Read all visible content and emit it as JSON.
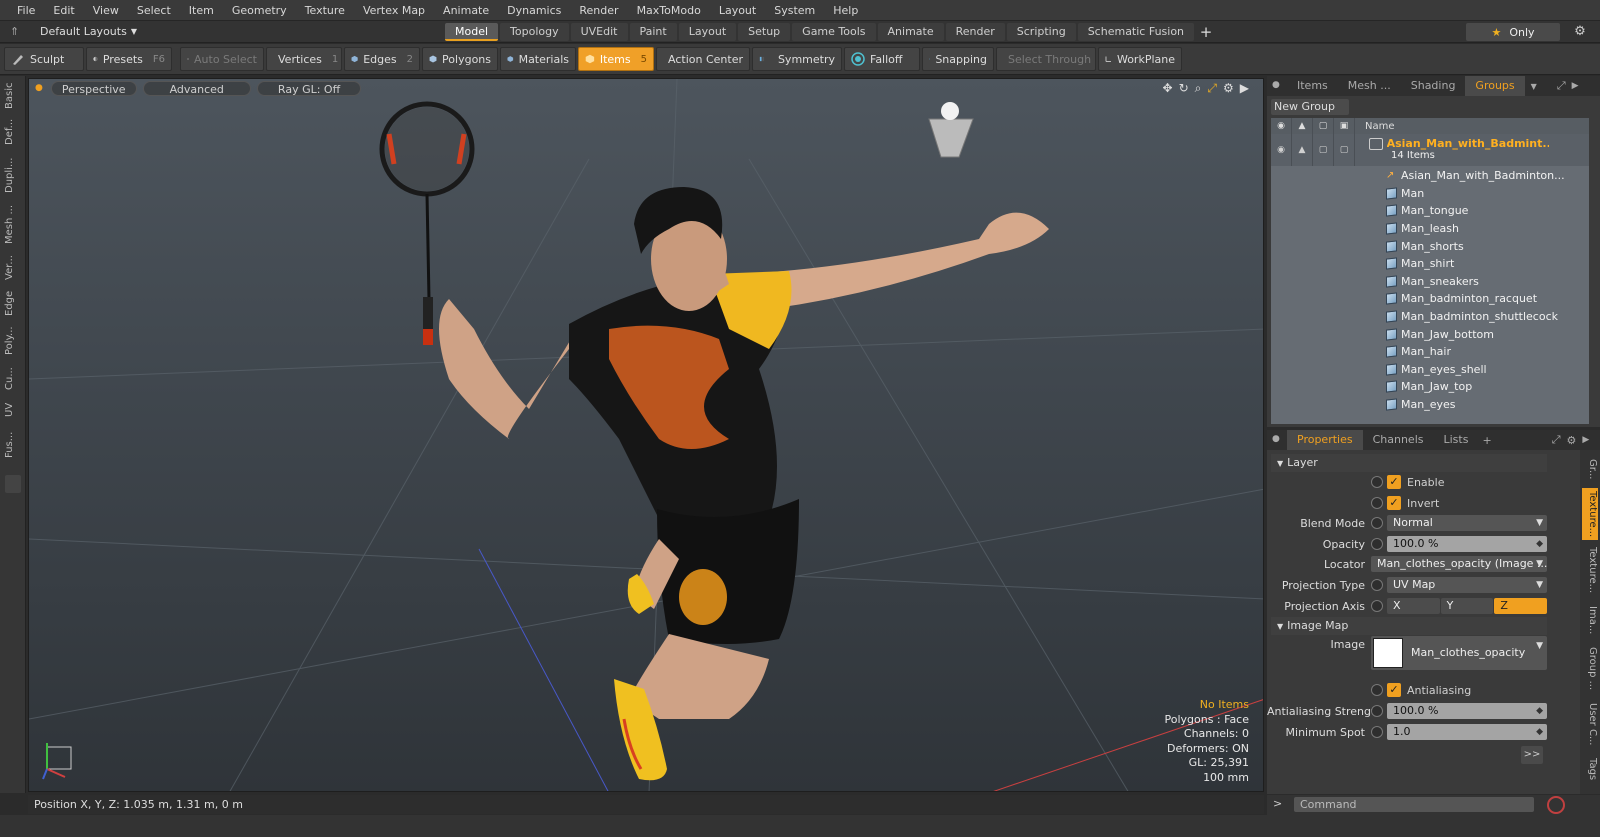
{
  "menu": [
    "File",
    "Edit",
    "View",
    "Select",
    "Item",
    "Geometry",
    "Texture",
    "Vertex Map",
    "Animate",
    "Dynamics",
    "Render",
    "MaxToModo",
    "Layout",
    "System",
    "Help"
  ],
  "layout": {
    "selector": "Default Layouts",
    "tabs": [
      "Model",
      "Topology",
      "UVEdit",
      "Paint",
      "Layout",
      "Setup",
      "Game Tools",
      "Animate",
      "Render",
      "Scripting",
      "Schematic Fusion"
    ],
    "selected_tab": "Model",
    "only_label": "Only"
  },
  "toolbar": {
    "sculpt": "Sculpt",
    "presets": "Presets",
    "presets_key": "F6",
    "auto_select": "Auto Select",
    "vertices": "Vertices",
    "vertices_key": "1",
    "edges": "Edges",
    "edges_key": "2",
    "polygons": "Polygons",
    "materials": "Materials",
    "items": "Items",
    "items_key": "5",
    "action_center": "Action Center",
    "symmetry": "Symmetry",
    "falloff": "Falloff",
    "snapping": "Snapping",
    "select_through": "Select Through",
    "workplane": "WorkPlane"
  },
  "left_tabs": [
    "Basic",
    "Def...",
    "Dupli...",
    "Mesh ...",
    "Ver...",
    "Edge",
    "Poly...",
    "Cu...",
    "UV",
    "Fus..."
  ],
  "viewport": {
    "perspective": "Perspective",
    "advanced": "Advanced",
    "raygl": "Ray GL: Off",
    "stats": {
      "no_items": "No Items",
      "polygons": "Polygons : Face",
      "channels": "Channels: 0",
      "deformers": "Deformers: ON",
      "gl": "GL: 25,391",
      "scale": "100 mm"
    }
  },
  "status": {
    "position": "Position X, Y, Z:  1.035 m, 1.31 m, 0 m"
  },
  "items_panel": {
    "tabs": [
      "Items",
      "Mesh ...",
      "Shading",
      "Groups"
    ],
    "selected_tab": "Groups",
    "new_group": "New Group",
    "col_name": "Name",
    "group_name": "Asian_Man_with_Badmint...",
    "group_count": "14 Items",
    "items": [
      "Asian_Man_with_Badminton...",
      "Man",
      "Man_tongue",
      "Man_leash",
      "Man_shorts",
      "Man_shirt",
      "Man_sneakers",
      "Man_badminton_racquet",
      "Man_badminton_shuttlecock",
      "Man_Jaw_bottom",
      "Man_hair",
      "Man_eyes_shell",
      "Man_Jaw_top",
      "Man_eyes"
    ]
  },
  "properties": {
    "tabs": [
      "Properties",
      "Channels",
      "Lists"
    ],
    "selected_tab": "Properties",
    "section_layer": "Layer",
    "enable": "Enable",
    "invert": "Invert",
    "blend_mode_label": "Blend Mode",
    "blend_mode": "Normal",
    "opacity_label": "Opacity",
    "opacity": "100.0 %",
    "locator_label": "Locator",
    "locator": "Man_clothes_opacity (Image ...",
    "projection_type_label": "Projection Type",
    "projection_type": "UV Map",
    "projection_axis_label": "Projection Axis",
    "axis": [
      "X",
      "Y",
      "Z"
    ],
    "axis_selected": "Z",
    "section_image_map": "Image Map",
    "image_label": "Image",
    "image": "Man_clothes_opacity",
    "antialiasing": "Antialiasing",
    "aa_strength_label": "Antialiasing Strength",
    "aa_strength": "100.0 %",
    "min_spot_label": "Minimum Spot",
    "min_spot": "1.0",
    "more": ">>",
    "side_tabs": [
      "Gr...",
      "Texture...",
      "Texture...",
      "Ima...",
      "Group ...",
      "User C...",
      "Tags"
    ]
  },
  "command": {
    "placeholder": "Command"
  },
  "colors": {
    "accent": "#f0a020",
    "viewport_top": "#4d555d",
    "viewport_bottom": "#2f3439"
  }
}
